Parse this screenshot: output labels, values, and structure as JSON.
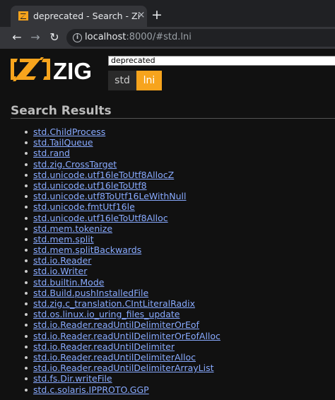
{
  "browser": {
    "tab_title": "deprecated - Search - Zig Documentation",
    "tab_close": "×",
    "new_tab": "+",
    "back": "←",
    "forward": "→",
    "reload": "↻",
    "info": "i",
    "url_host": "localhost",
    "url_rest": ":8000/#std.lni"
  },
  "page": {
    "logo_text": "ZIG",
    "search_value": "deprecated",
    "package_tabs": [
      "std",
      "lni"
    ],
    "results_heading": "Search Results",
    "results": [
      "std.ChildProcess",
      "std.TailQueue",
      "std.rand",
      "std.zig.CrossTarget",
      "std.unicode.utf16leToUtf8AllocZ",
      "std.unicode.utf16leToUtf8",
      "std.unicode.utf8ToUtf16LeWithNull",
      "std.unicode.fmtUtf16le",
      "std.unicode.utf16leToUtf8Alloc",
      "std.mem.tokenize",
      "std.mem.split",
      "std.mem.splitBackwards",
      "std.io.Reader",
      "std.io.Writer",
      "std.builtin.Mode",
      "std.Build.pushInstalledFile",
      "std.zig.c_translation.CIntLiteralRadix",
      "std.os.linux.io_uring_files_update",
      "std.io.Reader.readUntilDelimiterOrEof",
      "std.io.Reader.readUntilDelimiterOrEofAlloc",
      "std.io.Reader.readUntilDelimiter",
      "std.io.Reader.readUntilDelimiterAlloc",
      "std.io.Reader.readUntilDelimiterArrayList",
      "std.fs.Dir.writeFile",
      "std.c.solaris.IPPROTO.GGP"
    ]
  },
  "colors": {
    "brand": "#f7a41d",
    "link": "#88aaff",
    "background": "#111111"
  }
}
